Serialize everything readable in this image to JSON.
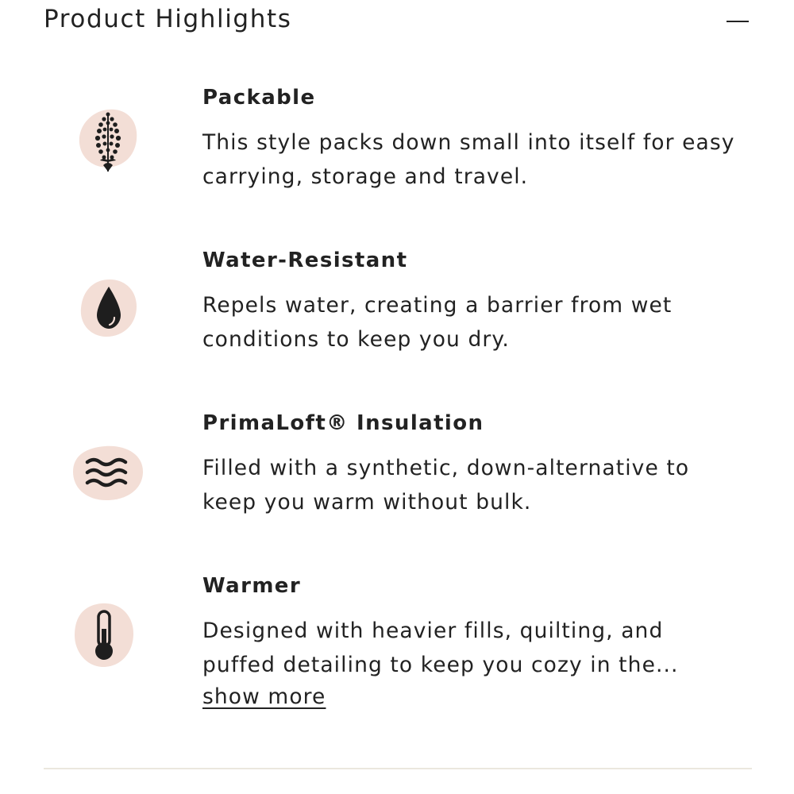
{
  "header": {
    "title": "Product Highlights",
    "toggle_icon": "minus-icon"
  },
  "colors": {
    "icon_blob": "#f3ded6",
    "icon_fill": "#1e1e1e",
    "text": "#222222",
    "divider": "#ebe7de"
  },
  "highlights": [
    {
      "icon": "leaf-sprig-icon",
      "title": "Packable",
      "description": "This style packs down small into itself for easy carrying, storage and travel."
    },
    {
      "icon": "water-drop-icon",
      "title": "Water-Resistant",
      "description": "Repels water, creating a barrier from wet conditions to keep you dry."
    },
    {
      "icon": "waves-icon",
      "title": "PrimaLoft® Insulation",
      "description": "Filled with a synthetic, down-alternative to keep you warm without bulk."
    },
    {
      "icon": "thermometer-icon",
      "title": "Warmer",
      "description": "Designed with heavier fills, quilting, and puffed detailing to keep you cozy in the...",
      "link": "show more"
    }
  ]
}
